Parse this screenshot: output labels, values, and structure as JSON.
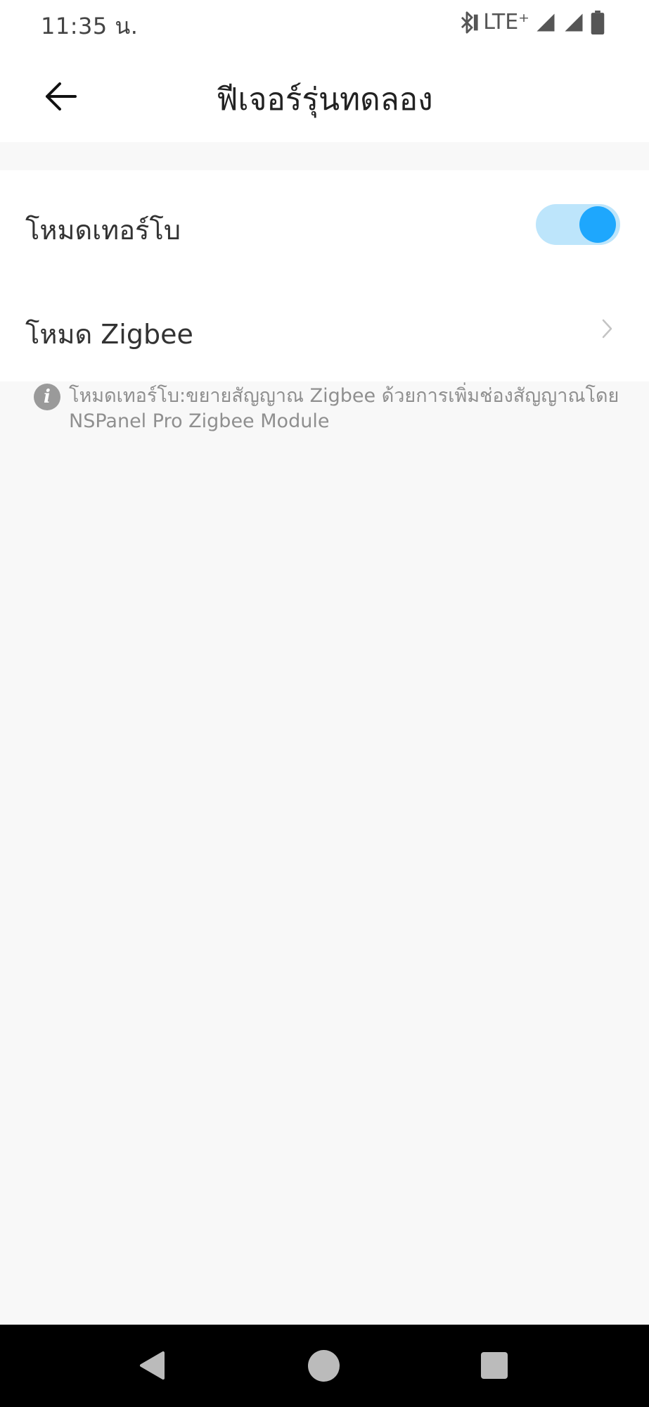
{
  "status_bar": {
    "time": "11:35 น.",
    "network": "LTE⁺",
    "icons": [
      "bluetooth-icon",
      "signal-icon",
      "signal-icon",
      "battery-icon"
    ]
  },
  "header": {
    "back_icon": "arrow-left-icon",
    "title": "ฟีเจอร์รุ่นทดลอง"
  },
  "settings": {
    "turbo_mode": {
      "label": "โหมดเทอร์โบ",
      "enabled": true
    },
    "zigbee_mode": {
      "label": "โหมด Zigbee",
      "icon": "chevron-right-icon"
    }
  },
  "note": {
    "icon": "info-icon",
    "icon_glyph": "i",
    "text": "โหมดเทอร์โบ:ขยายสัญญาณ Zigbee ด้วยการเพิ่มช่องสัญญาณโดย NSPanel Pro Zigbee Module"
  },
  "nav_bar": {
    "buttons": [
      "back-triangle-icon",
      "home-circle-icon",
      "recents-square-icon"
    ]
  },
  "colors": {
    "accent": "#1ea7fd",
    "toggle_track": "#bde5fb",
    "page_background": "#f8f8f8",
    "card_background": "#ffffff",
    "note_text": "#8f8f8f",
    "nav_background": "#000000"
  }
}
